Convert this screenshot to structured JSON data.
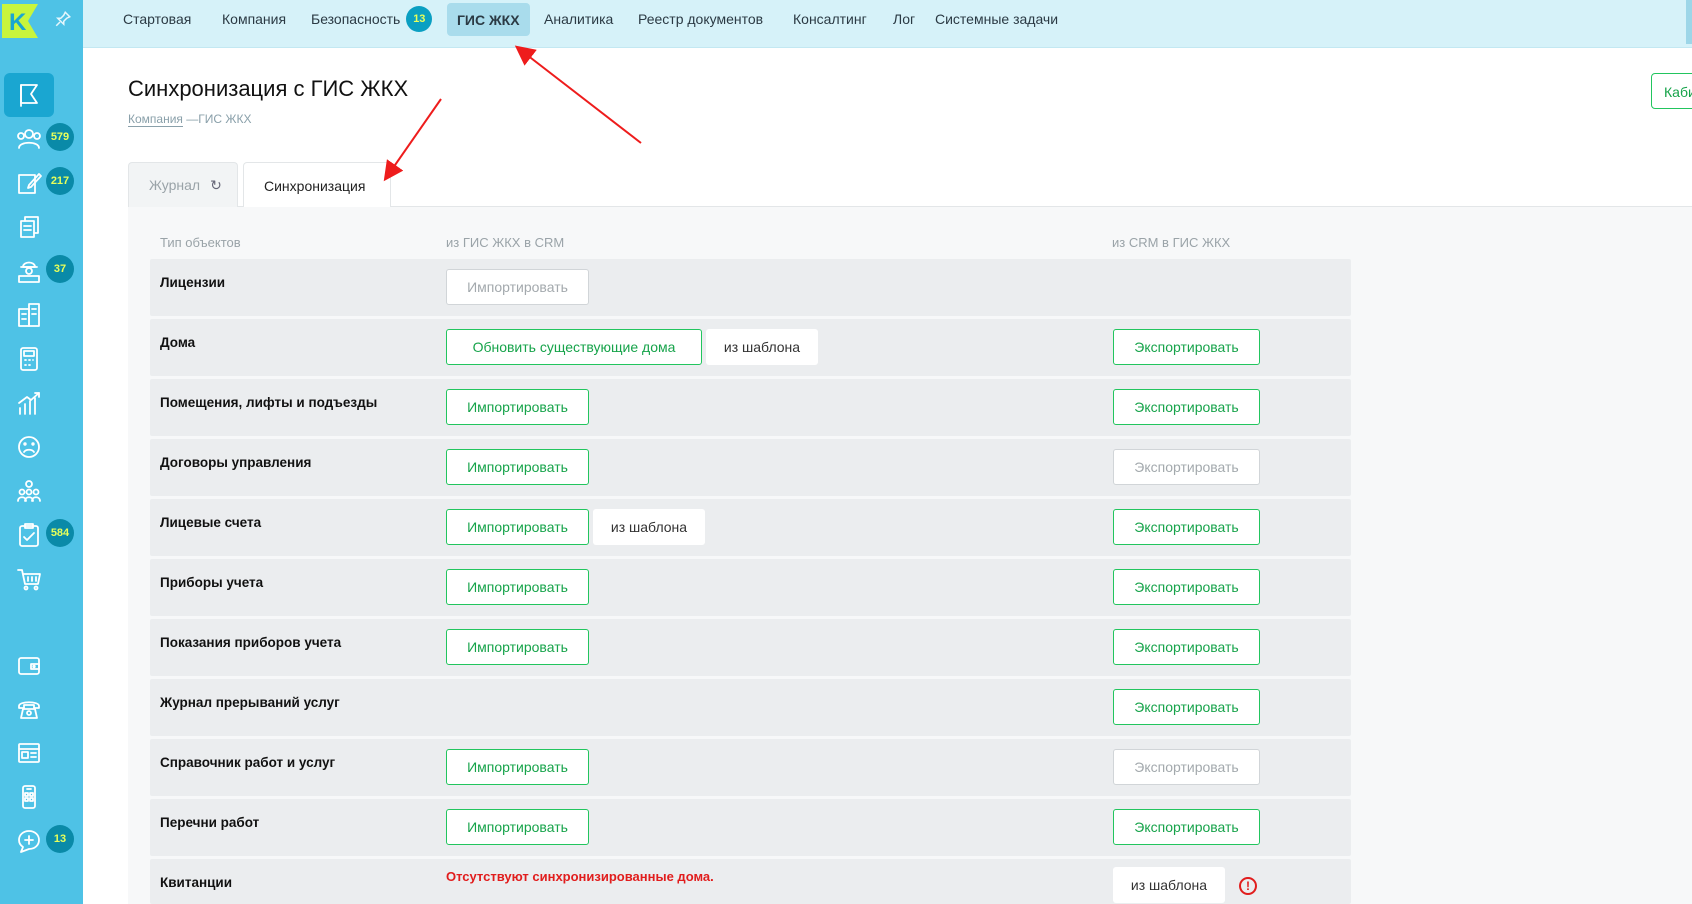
{
  "sidebar": {
    "logo_letter": "K",
    "items": [
      {
        "icon": "flag-icon",
        "badge": ""
      },
      {
        "icon": "users-icon",
        "badge": "579"
      },
      {
        "icon": "edit-icon",
        "badge": "217"
      },
      {
        "icon": "documents-icon",
        "badge": ""
      },
      {
        "icon": "worker-icon",
        "badge": "37"
      },
      {
        "icon": "building-icon",
        "badge": ""
      },
      {
        "icon": "calculator-icon",
        "badge": ""
      },
      {
        "icon": "chart-icon",
        "badge": ""
      },
      {
        "icon": "sad-face-icon",
        "badge": ""
      },
      {
        "icon": "group-icon",
        "badge": ""
      },
      {
        "icon": "checklist-icon",
        "badge": "584"
      },
      {
        "icon": "cart-icon",
        "badge": ""
      },
      {
        "icon": "wallet-icon",
        "badge": ""
      },
      {
        "icon": "phone-icon",
        "badge": ""
      },
      {
        "icon": "dashboard-icon",
        "badge": ""
      },
      {
        "icon": "mobile-icon",
        "badge": ""
      },
      {
        "icon": "chat-plus-icon",
        "badge": "13"
      }
    ]
  },
  "topnav": {
    "items": [
      {
        "label": "Стартовая"
      },
      {
        "label": "Компания"
      },
      {
        "label": "Безопасность",
        "badge": "13"
      },
      {
        "label": "ГИС ЖКХ",
        "active": true
      },
      {
        "label": "Аналитика"
      },
      {
        "label": "Реестр документов"
      },
      {
        "label": "Консалтинг"
      },
      {
        "label": "Лог"
      },
      {
        "label": "Системные задачи"
      }
    ]
  },
  "page": {
    "title": "Синхронизация с ГИС ЖКХ",
    "breadcrumb_link": "Компания",
    "breadcrumb_sep": "—",
    "breadcrumb_current": "ГИС ЖКХ",
    "cabinet_button": "Каби"
  },
  "tabs": [
    {
      "label": "Журнал",
      "refresh": "↻"
    },
    {
      "label": "Синхронизация"
    }
  ],
  "table": {
    "headers": {
      "type": "Тип объектов",
      "from_gis": "из ГИС ЖКХ в CRM",
      "to_gis": "из CRM в ГИС ЖКХ"
    },
    "rows": [
      {
        "label": "Лицензии",
        "import": "Импортировать",
        "import_disabled": true
      },
      {
        "label": "Дома",
        "import": "Обновить существующие дома",
        "import_tpl": "из шаблона",
        "export": "Экспортировать"
      },
      {
        "label": "Помещения, лифты и подъезды",
        "import": "Импортировать",
        "export": "Экспортировать"
      },
      {
        "label": "Договоры управления",
        "import": "Импортировать",
        "export": "Экспортировать",
        "export_disabled": true
      },
      {
        "label": "Лицевые счета",
        "import": "Импортировать",
        "import_tpl": "из шаблона",
        "export": "Экспортировать"
      },
      {
        "label": "Приборы учета",
        "import": "Импортировать",
        "export": "Экспортировать"
      },
      {
        "label": "Показания приборов учета",
        "import": "Импортировать",
        "export": "Экспортировать"
      },
      {
        "label": "Журнал прерываний услуг",
        "export": "Экспортировать"
      },
      {
        "label": "Справочник работ и услуг",
        "import": "Импортировать",
        "export": "Экспортировать",
        "export_disabled": true
      },
      {
        "label": "Перечни работ",
        "import": "Импортировать",
        "export": "Экспортировать"
      },
      {
        "label": "Квитанции",
        "warning": "Отсутствуют синхронизированные дома.",
        "export_tpl": "из шаблона",
        "error_icon": "!"
      }
    ]
  },
  "colors": {
    "sidebar": "#4ec2e6",
    "topnav": "#d6f2f9",
    "accent_green": "#22c55e",
    "error_red": "#e11d1d",
    "badge_text": "#e8ff5a"
  }
}
